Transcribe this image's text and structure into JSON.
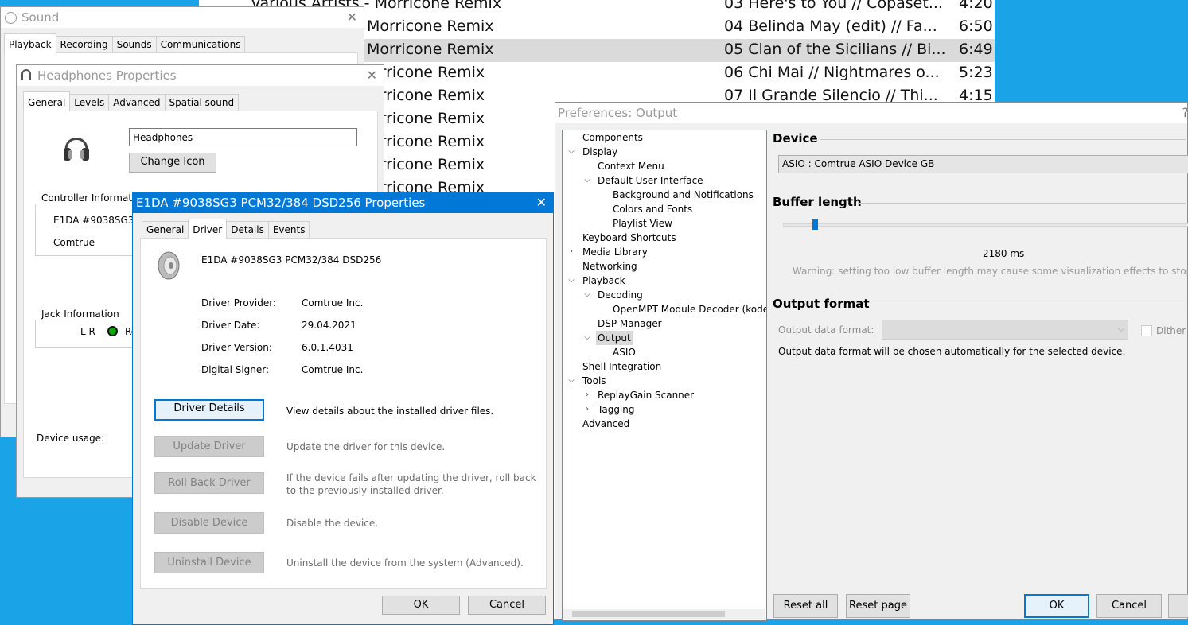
{
  "playlist": {
    "rows": [
      {
        "album": "Various Artists - Morricone Remix",
        "track": "03  Here's to You // Copaset...",
        "duration": "4:20",
        "selected": false
      },
      {
        "album": "Morricone Remix",
        "track": "04  Belinda May (edit) // Fa...",
        "duration": "6:50",
        "selected": false
      },
      {
        "album": "Morricone Remix",
        "track": "05  Clan of the Sicilians // Bi...",
        "duration": "6:49",
        "selected": true
      },
      {
        "album": "orricone Remix",
        "track": "06  Chi Mai // Nightmares o...",
        "duration": "5:23",
        "selected": false
      },
      {
        "album": "orricone Remix",
        "track": "07  Il Grande Silencio // Thi...",
        "duration": "4:15",
        "selected": false
      },
      {
        "album": "orricone Remix",
        "track": "",
        "duration": "",
        "selected": false
      },
      {
        "album": "orricone Remix",
        "track": "",
        "duration": "",
        "selected": false
      },
      {
        "album": "orricone Remix",
        "track": "",
        "duration": "",
        "selected": false
      },
      {
        "album": "orricone Remix",
        "track": "",
        "duration": "",
        "selected": false
      }
    ]
  },
  "sound": {
    "title": "Sound",
    "tabs": [
      "Playback",
      "Recording",
      "Sounds",
      "Communications"
    ]
  },
  "headphones": {
    "title": "Headphones Properties",
    "tabs": [
      "General",
      "Levels",
      "Advanced",
      "Spatial sound"
    ],
    "name_value": "Headphones",
    "change_icon": "Change Icon",
    "controller_label": "Controller Information",
    "controller_name": "E1DA #9038SG3",
    "controller_vendor": "Comtrue",
    "jack_label": "Jack Information",
    "jack_lr": "L R",
    "jack_rear": "Re",
    "device_usage": "Device usage:"
  },
  "driver": {
    "title": "E1DA #9038SG3 PCM32/384 DSD256 Properties",
    "tabs": [
      "General",
      "Driver",
      "Details",
      "Events"
    ],
    "device_name": "E1DA #9038SG3 PCM32/384 DSD256",
    "provider_label": "Driver Provider:",
    "provider_value": "Comtrue Inc.",
    "date_label": "Driver Date:",
    "date_value": "29.04.2021",
    "version_label": "Driver Version:",
    "version_value": "6.0.1.4031",
    "signer_label": "Digital Signer:",
    "signer_value": "Comtrue Inc.",
    "details_btn": "Driver Details",
    "details_desc": "View details about the installed driver files.",
    "update_btn": "Update Driver",
    "update_desc": "Update the driver for this device.",
    "rollback_btn": "Roll Back Driver",
    "rollback_desc_1": "If the device fails after updating the driver, roll back",
    "rollback_desc_2": "to the previously installed driver.",
    "disable_btn": "Disable Device",
    "disable_desc": "Disable the device.",
    "uninstall_btn": "Uninstall Device",
    "uninstall_desc": "Uninstall the device from the system (Advanced).",
    "ok": "OK",
    "cancel": "Cancel"
  },
  "prefs": {
    "title": "Preferences: Output",
    "help": "?",
    "tree": {
      "components": "Components",
      "display": "Display",
      "context_menu": "Context Menu",
      "default_ui": "Default User Interface",
      "bg_notif": "Background and Notifications",
      "colors_fonts": "Colors and Fonts",
      "playlist_view": "Playlist View",
      "keyboard": "Keyboard Shortcuts",
      "media_library": "Media Library",
      "networking": "Networking",
      "playback": "Playback",
      "decoding": "Decoding",
      "openmpt": "OpenMPT Module Decoder (kode",
      "dsp": "DSP Manager",
      "output": "Output",
      "asio": "ASIO",
      "shell": "Shell Integration",
      "tools": "Tools",
      "replaygain": "ReplayGain Scanner",
      "tagging": "Tagging",
      "advanced": "Advanced"
    },
    "device_head": "Device",
    "device_value": "ASIO : Comtrue ASIO Device GB",
    "buffer_head": "Buffer length",
    "buffer_value": "2180 ms",
    "buffer_fraction": 0.08,
    "warning": "Warning: setting too low buffer length may cause some visualization effects to stop wo",
    "format_head": "Output format",
    "format_label": "Output data format:",
    "dither": "Dither",
    "format_note": "Output data format will be chosen automatically for the selected device.",
    "reset_all": "Reset all",
    "reset_page": "Reset page",
    "ok": "OK",
    "cancel": "Cancel"
  }
}
